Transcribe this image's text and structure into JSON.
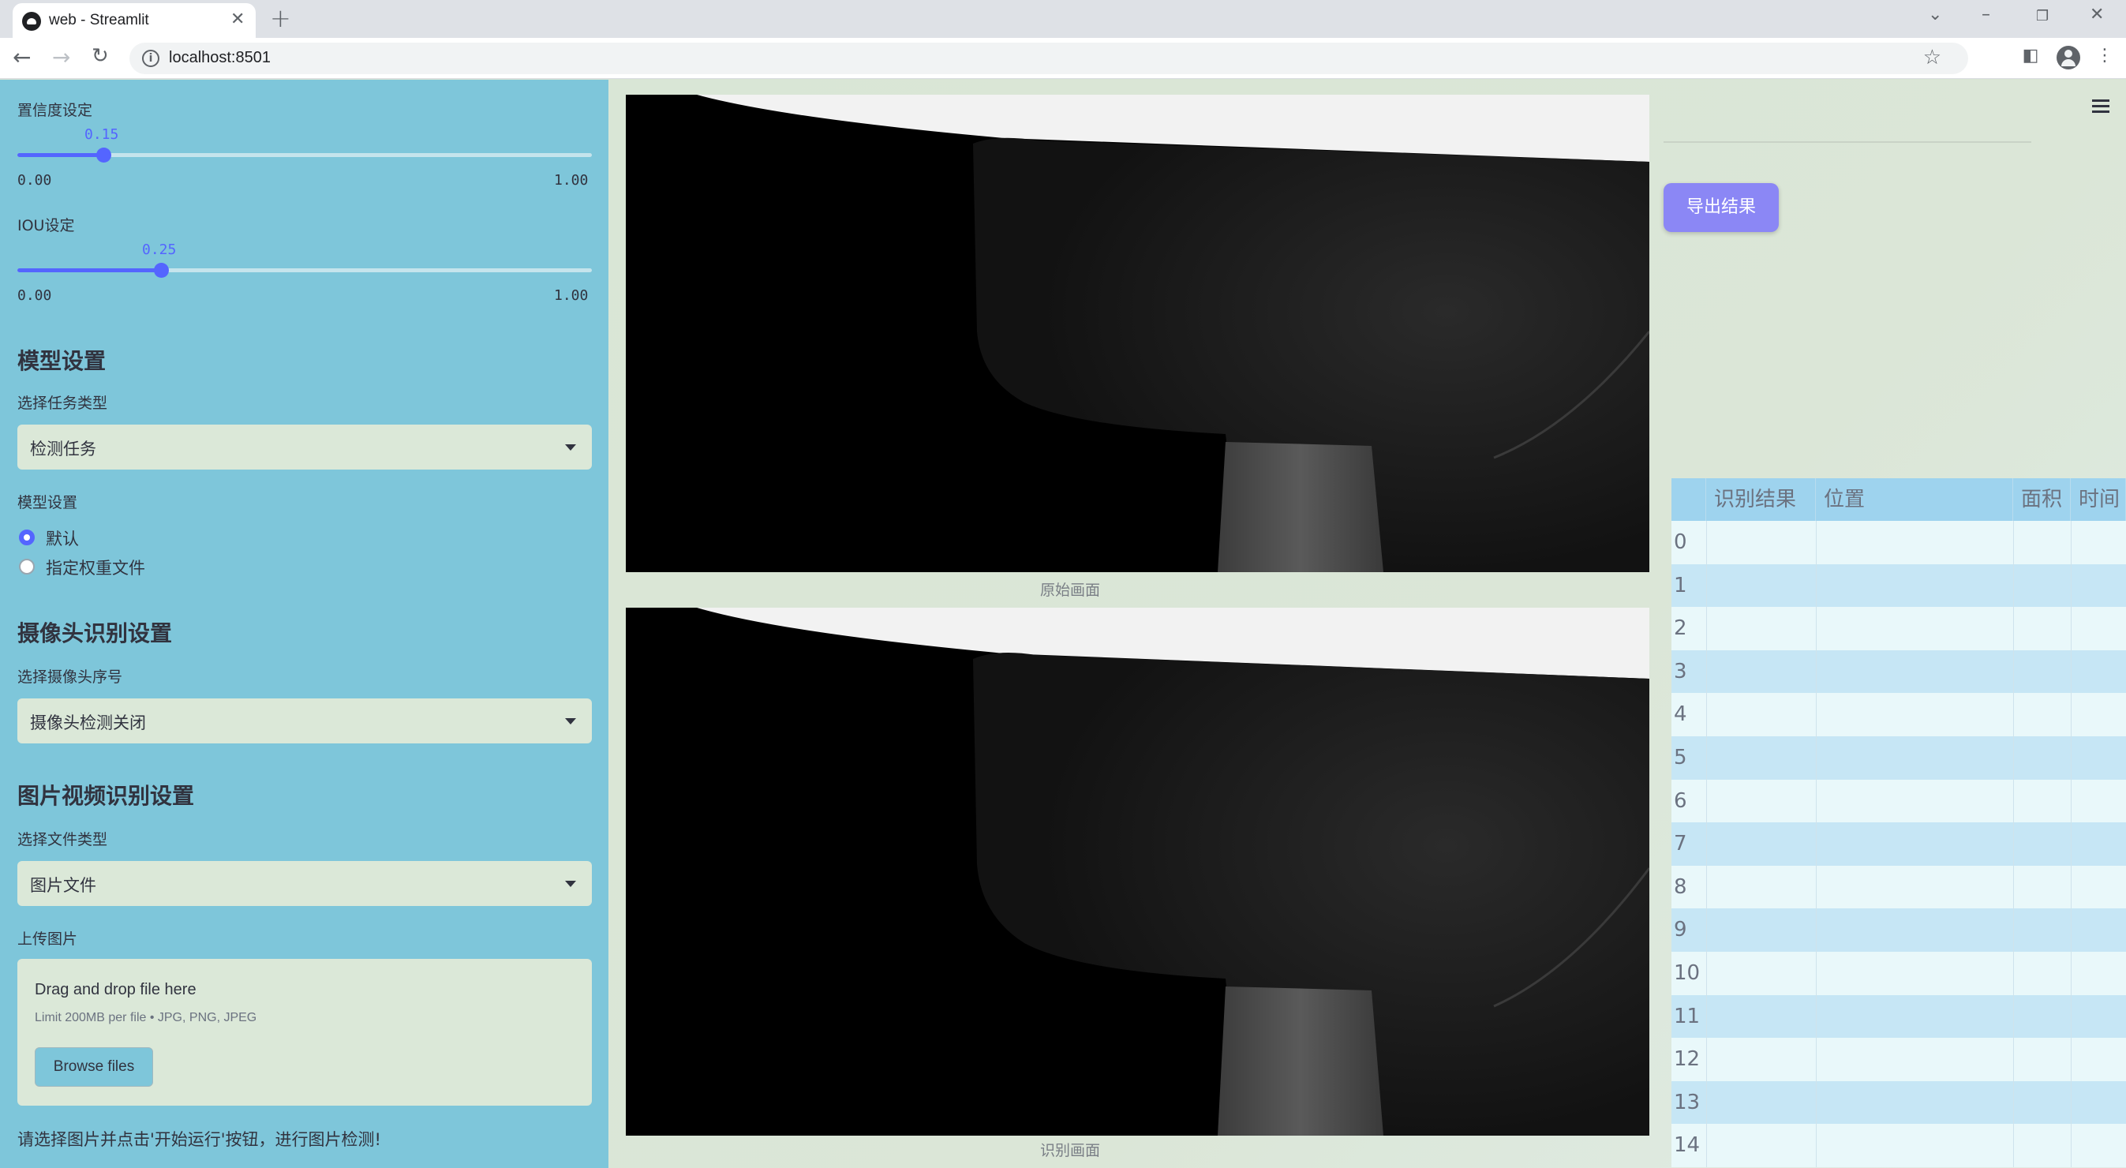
{
  "browser": {
    "tab_title": "web - Streamlit",
    "url": "localhost:8501"
  },
  "sidebar": {
    "confidence": {
      "label": "置信度设定",
      "value": "0.15",
      "min": "0.00",
      "max": "1.00",
      "fraction": 0.15
    },
    "iou": {
      "label": "IOU设定",
      "value": "0.25",
      "min": "0.00",
      "max": "1.00",
      "fraction": 0.25
    },
    "model_heading": "模型设置",
    "task_label": "选择任务类型",
    "task_value": "检测任务",
    "model_label": "模型设置",
    "model_options": [
      "默认",
      "指定权重文件"
    ],
    "model_selected": 0,
    "camera_heading": "摄像头识别设置",
    "camera_label": "选择摄像头序号",
    "camera_value": "摄像头检测关闭",
    "media_heading": "图片视频识别设置",
    "filetype_label": "选择文件类型",
    "filetype_value": "图片文件",
    "upload_label": "上传图片",
    "uploader": {
      "title": "Drag and drop file here",
      "limit": "Limit 200MB per file • JPG, PNG, JPEG",
      "button": "Browse files"
    },
    "note": "请选择图片并点击'开始运行'按钮，进行图片检测!"
  },
  "main": {
    "original_caption": "原始画面",
    "result_caption": "识别画面",
    "export_button": "导出结果",
    "table": {
      "columns": [
        "",
        "识别结果",
        "位置",
        "面积",
        "时间"
      ],
      "rows": [
        "0",
        "1",
        "2",
        "3",
        "4",
        "5",
        "6",
        "7",
        "8",
        "9",
        "10",
        "11",
        "12",
        "13",
        "14"
      ]
    }
  },
  "colors": {
    "sidebar_bg": "#7ec6da",
    "accent": "#5465ff",
    "export_button": "#8b87f5",
    "table_header": "#9ed3ee"
  }
}
